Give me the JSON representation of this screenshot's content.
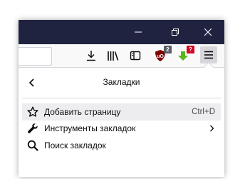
{
  "titlebar": {
    "minimize_icon": "minimize-icon",
    "restore_icon": "restore-icon",
    "close_icon": "close-icon"
  },
  "toolbar": {
    "icons": [
      "download-icon",
      "library-icon",
      "sidebar-icon",
      "ublock-icon",
      "download-extension-icon",
      "hamburger-menu-icon"
    ],
    "ublock_badge": "2",
    "ext_badge": "?"
  },
  "panel": {
    "title": "Закладки",
    "items": [
      {
        "label": "Добавить страницу",
        "shortcut": "Ctrl+D",
        "icon": "star-icon"
      },
      {
        "label": "Инструменты закладок",
        "icon": "wrench-icon"
      },
      {
        "label": "Поиск закладок",
        "icon": "search-icon"
      }
    ]
  },
  "colors": {
    "titlebar": "#202340",
    "toolbar": "#f9f9fa",
    "hover": "#ededf0",
    "ublock": "#800000",
    "ext_green": "#58b51e"
  }
}
